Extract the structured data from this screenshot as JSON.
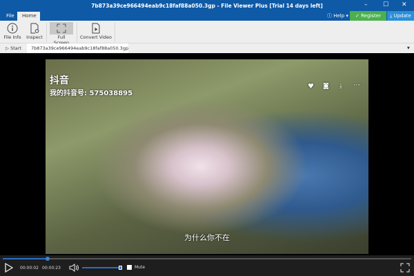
{
  "window": {
    "title": "7b873a39ce966494eab9c18faf88a050.3gp - File Viewer Plus [Trial 14 days left]",
    "accent": "#0e5aa7"
  },
  "menu": {
    "file": "File",
    "home": "Home",
    "help": "Help",
    "register": "Register",
    "update": "Update",
    "register_color": "#4caf50",
    "update_color": "#2a8fd8"
  },
  "ribbon": {
    "file_info": "File Info",
    "inspect": "Inspect",
    "full_screen": "Full Screen",
    "convert_video": "Convert Video"
  },
  "tabs": {
    "start": "Start",
    "file_tab": "7b873a39ce966494eab9c18faf88a050.3gp"
  },
  "video": {
    "brand": "抖音",
    "account": "我的抖音号: 575038895",
    "subtitle": "为什么你不在"
  },
  "player": {
    "current_time": "00:00:02",
    "duration": "00:00:23",
    "progress_fraction": 0.11,
    "volume_fraction": 1.0,
    "mute_label": "Mute",
    "muted": false
  }
}
